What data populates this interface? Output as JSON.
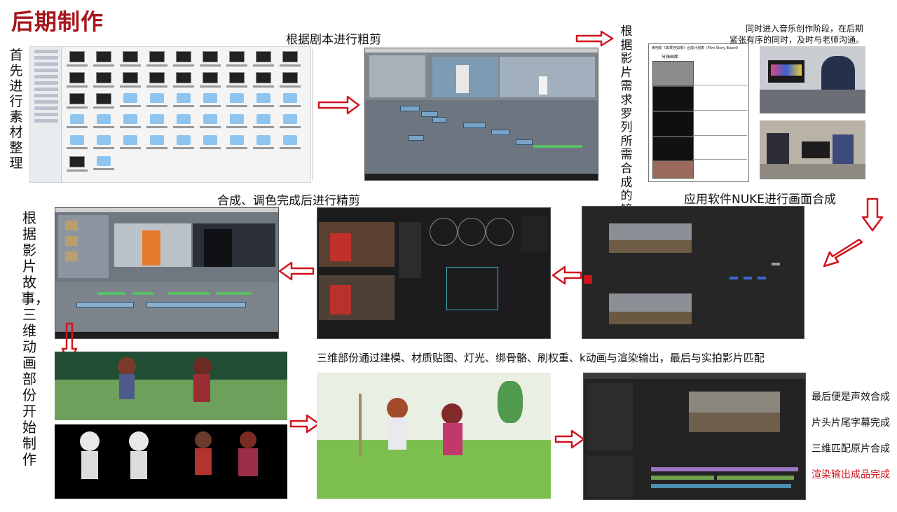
{
  "title": "后期制作",
  "captions": {
    "rough_cut": "根据剧本进行粗剪",
    "fine_cut": "合成、调色完成后进行精剪",
    "nuke": "应用软件NUKE进行画面合成",
    "three_d": "三维部份通过建模、材质贴图、灯光、绑骨骼、刷权重、k动画与渲染输出，最后与实拍影片匹配",
    "music_line1": "同时进入音乐创作阶段，在后期",
    "music_line2": "紧张有序的同时，及时与老师沟通。"
  },
  "vertical": {
    "organize": "首先进行素材整理",
    "storyboard": "根据影片需求罗列所需合成的镜头",
    "animation": "根据影片故事，三维动画部份开始制作"
  },
  "storyboard_doc": {
    "heading": "微电影《如果存如果》合成计划表（Film Story Board）",
    "column_header": "分镜画面"
  },
  "final_steps": [
    {
      "text": "最后便是声效合成",
      "color": "#111111"
    },
    {
      "text": "片头片尾字幕完成",
      "color": "#111111"
    },
    {
      "text": "三维匹配原片合成",
      "color": "#111111"
    },
    {
      "text": "渲染输出成品完成",
      "color": "#d1141c"
    }
  ],
  "colors": {
    "title": "#a8161d",
    "arrow": "#d1141c",
    "accent_red": "#d1141c"
  },
  "icons": [
    "arrow-right-icon",
    "arrow-down-icon",
    "arrow-left-icon",
    "folder-icon"
  ]
}
